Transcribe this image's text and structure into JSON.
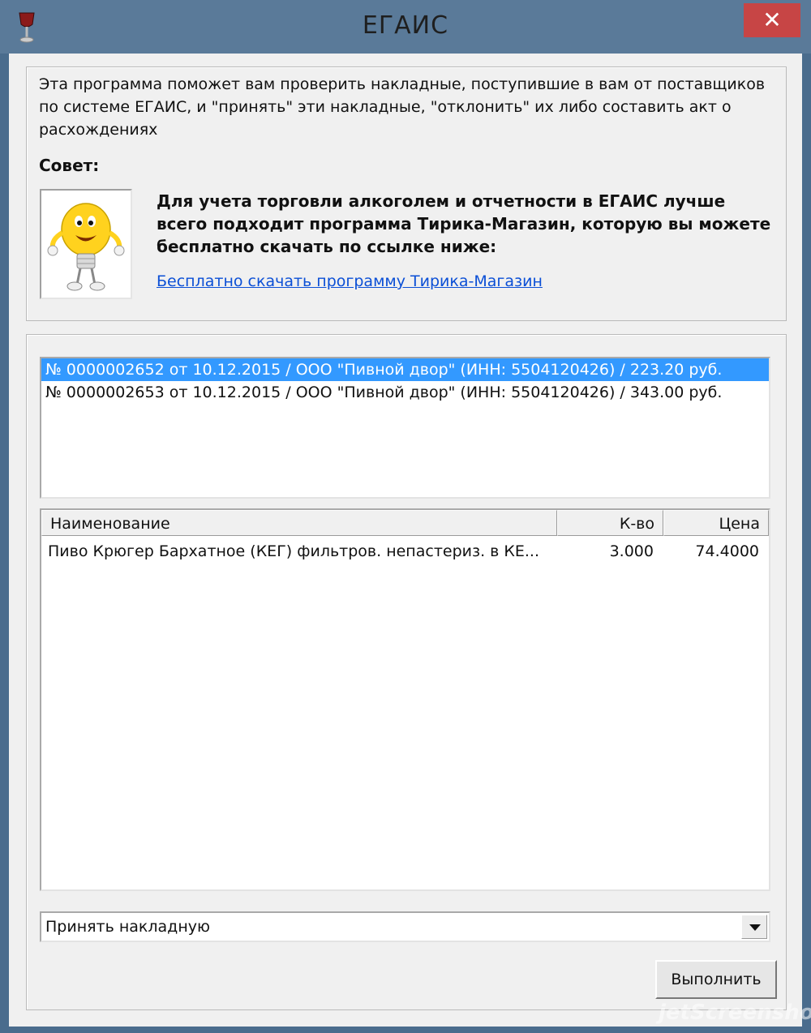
{
  "window": {
    "title": "ЕГАИС",
    "close_glyph": "✕"
  },
  "info": {
    "intro": "Эта программа поможет вам проверить накладные, поступившие в вам от поставщиков по системе ЕГАИС, и \"принять\" эти накладные, \"отклонить\" их либо составить акт о расхождениях",
    "tip_label": "Совет:",
    "tip_text": "Для учета торговли алкоголем и отчетности в ЕГАИС лучше всего подходит программа Тирика-Магазин, которую вы можете бесплатно скачать по ссылке ниже:",
    "link_text": "Бесплатно скачать программу Тирика-Магазин"
  },
  "invoices": [
    {
      "label": "№ 0000002652 от 10.12.2015 / ООО \"Пивной двор\" (ИНН: 5504120426) / 223.20 руб.",
      "selected": true
    },
    {
      "label": "№ 0000002653 от 10.12.2015 / ООО \"Пивной двор\" (ИНН: 5504120426) / 343.00 руб.",
      "selected": false
    }
  ],
  "items_table": {
    "columns": [
      "Наименование",
      "К-во",
      "Цена"
    ],
    "rows": [
      {
        "name": "Пиво Крюгер Бархатное (КЕГ) фильтров. непастериз. в КЕ...",
        "qty": "3.000",
        "price": "74.4000"
      }
    ]
  },
  "action": {
    "selected": "Принять накладную",
    "execute_label": "Выполнить"
  },
  "watermark": "jetScreenshot",
  "colors": {
    "selection": "#3399ff",
    "link": "#0b4fd6",
    "close": "#c74545"
  }
}
